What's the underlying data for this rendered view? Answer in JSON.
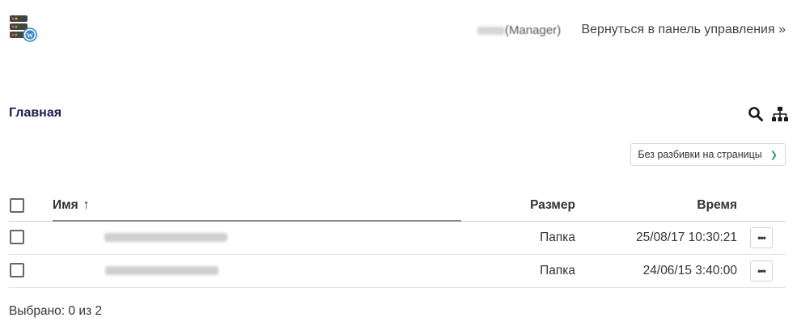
{
  "header": {
    "user_label": "(Manager)",
    "back_link": "Вернуться в панель управления »"
  },
  "breadcrumb": {
    "label": "Главная"
  },
  "toolbar": {
    "search_icon": "search-icon",
    "sitemap_icon": "sitemap-icon"
  },
  "paging": {
    "selected": "Без разбивки на страницы"
  },
  "table": {
    "columns": {
      "name": "Имя",
      "size": "Размер",
      "time": "Время"
    },
    "sort_indicator": "↑",
    "rows": [
      {
        "name": "",
        "size": "Папка",
        "time": "25/08/17 10:30:21",
        "actions": "•••"
      },
      {
        "name": "",
        "size": "Папка",
        "time": "24/06/15 3:40:00",
        "actions": "•••"
      }
    ]
  },
  "status": {
    "selection": "Выбрано: 0 из 2"
  },
  "colors": {
    "accent": "#1a1f4a",
    "chevron": "#2a9d6e"
  }
}
